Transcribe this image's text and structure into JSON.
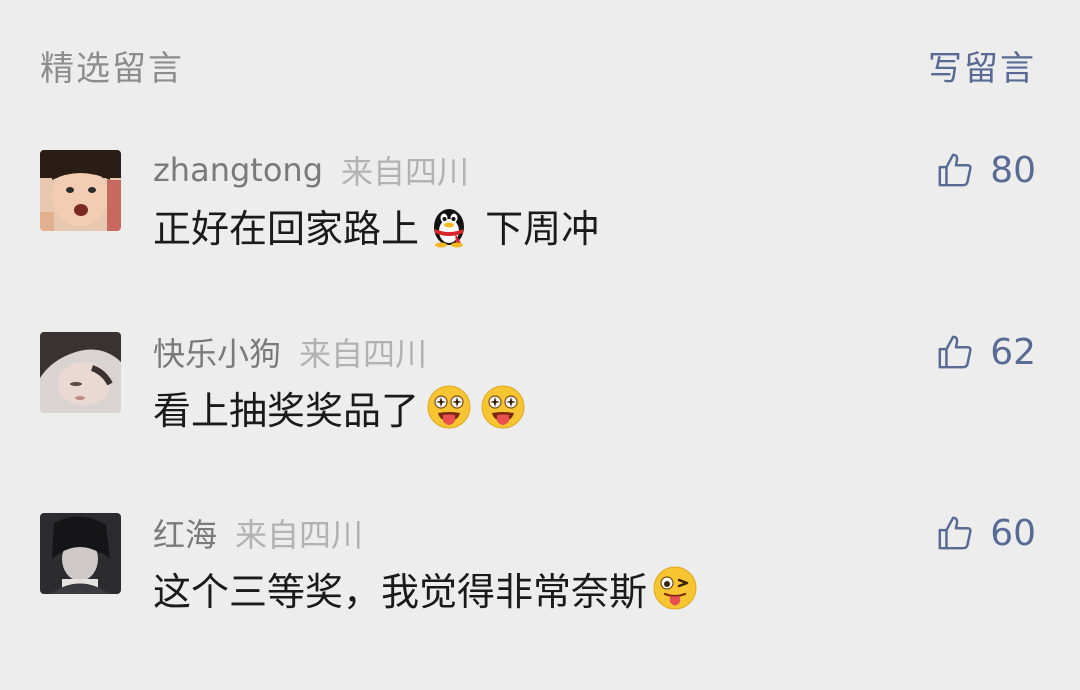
{
  "header": {
    "title": "精选留言",
    "write_label": "写留言"
  },
  "colors": {
    "background": "#ededed",
    "link": "#576b95",
    "username": "#7a7a7a",
    "location": "#b2b2b2",
    "text": "#1a1a1a"
  },
  "comments": [
    {
      "username": "zhangtong",
      "location": "来自四川",
      "text_before": "正好在回家路上",
      "emoji": "qq-penguin-emoji",
      "text_after": " 下周冲",
      "likes": "80"
    },
    {
      "username": "快乐小狗",
      "location": "来自四川",
      "text_before": "看上抽奖奖品了",
      "emoji": "starry-eyed-tongue-emoji",
      "text_after": "",
      "likes": "62"
    },
    {
      "username": "红海",
      "location": "来自四川",
      "text_before": "这个三等奖，我觉得非常奈斯",
      "emoji": "winking-tongue-emoji",
      "text_after": "",
      "likes": "60"
    }
  ]
}
